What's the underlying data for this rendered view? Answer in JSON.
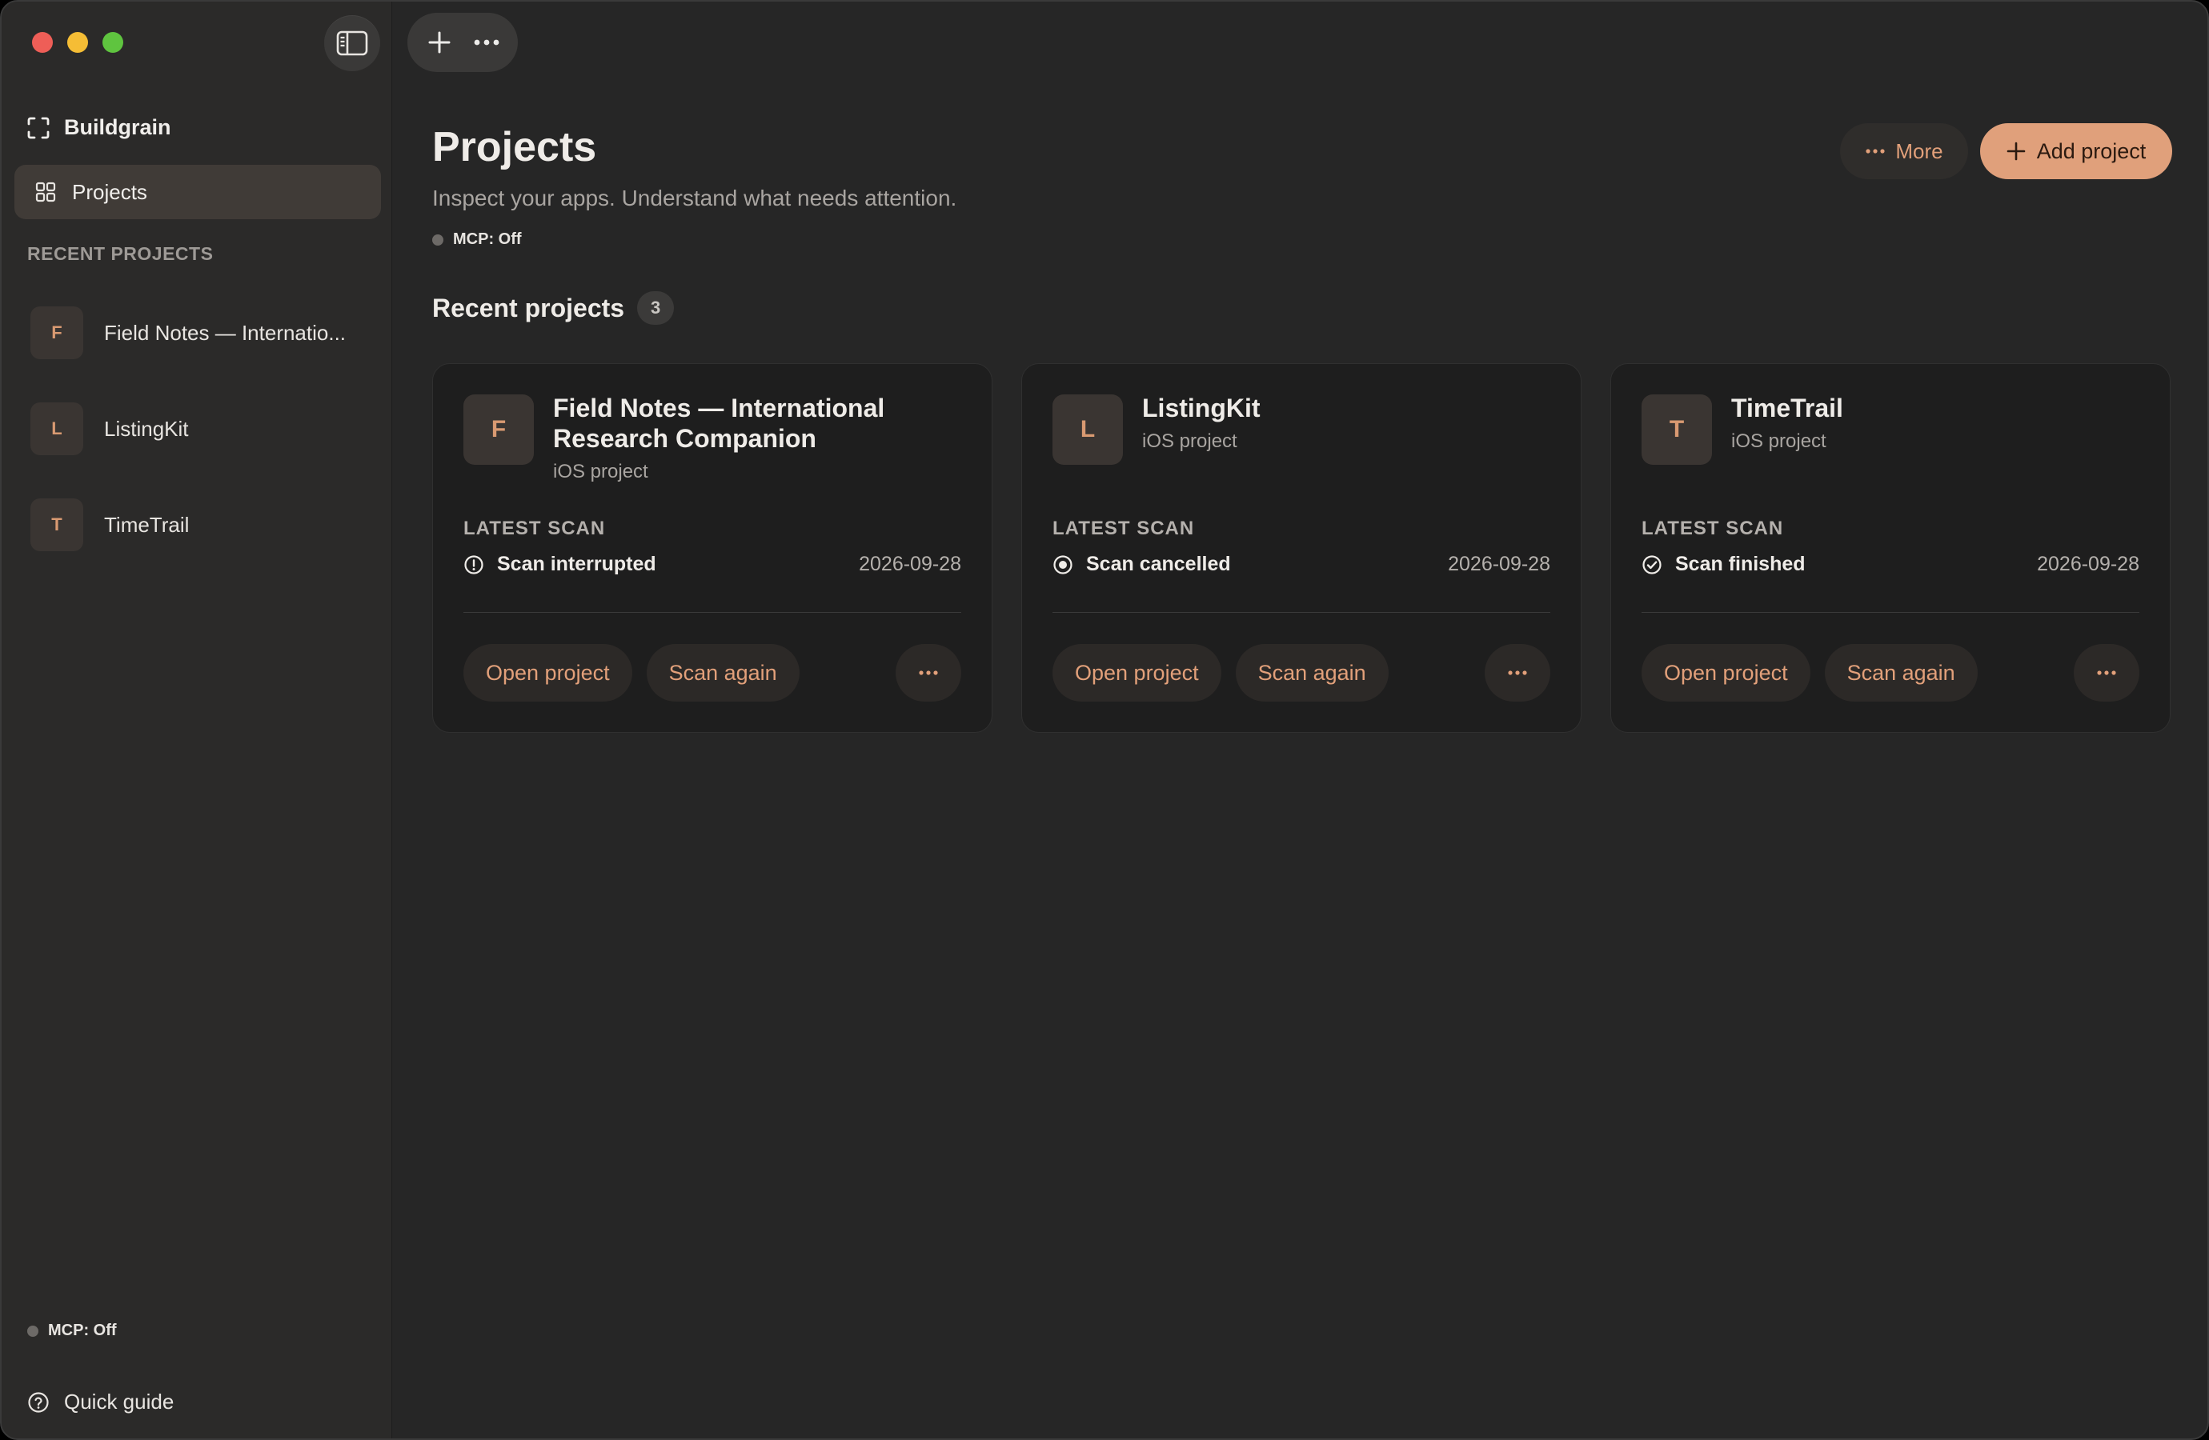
{
  "app": {
    "name": "Buildgrain"
  },
  "colors": {
    "accent": "#e0a07b",
    "accent_text": "#e2a07a",
    "background": "#262626",
    "card": "#1e1e1e"
  },
  "sidebar": {
    "brand": "Buildgrain",
    "nav": {
      "projects_label": "Projects"
    },
    "recent_label": "RECENT PROJECTS",
    "recent_items": [
      {
        "initial": "F",
        "name": "Field Notes — Internatio..."
      },
      {
        "initial": "L",
        "name": "ListingKit"
      },
      {
        "initial": "T",
        "name": "TimeTrail"
      }
    ],
    "mcp_status": "MCP: Off",
    "quick_guide": "Quick guide"
  },
  "header": {
    "title": "Projects",
    "subtitle": "Inspect your apps. Understand what needs attention.",
    "mcp_status": "MCP: Off",
    "more_label": "More",
    "add_label": "Add project"
  },
  "section": {
    "title": "Recent projects",
    "count": "3"
  },
  "projects": [
    {
      "initial": "F",
      "title": "Field Notes — International Research Companion",
      "type": "iOS project",
      "scan_label": "LATEST SCAN",
      "scan_status": "Scan interrupted",
      "scan_icon": "info-icon",
      "scan_date": "2026-09-28",
      "open_label": "Open project",
      "scan_again_label": "Scan again"
    },
    {
      "initial": "L",
      "title": "ListingKit",
      "type": "iOS project",
      "scan_label": "LATEST SCAN",
      "scan_status": "Scan cancelled",
      "scan_icon": "stop-circle-icon",
      "scan_date": "2026-09-28",
      "open_label": "Open project",
      "scan_again_label": "Scan again"
    },
    {
      "initial": "T",
      "title": "TimeTrail",
      "type": "iOS project",
      "scan_label": "LATEST SCAN",
      "scan_status": "Scan finished",
      "scan_icon": "check-circle-icon",
      "scan_date": "2026-09-28",
      "open_label": "Open project",
      "scan_again_label": "Scan again"
    }
  ]
}
